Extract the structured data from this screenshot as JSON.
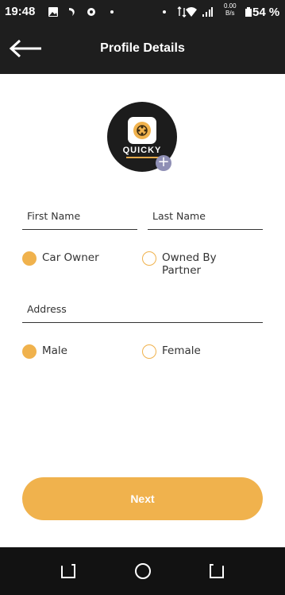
{
  "status_bar": {
    "time": "19:48",
    "net_speed_value": "0.00",
    "net_speed_unit": "B/s",
    "battery": "54 %",
    "icons": [
      "gallery-icon",
      "app-icon",
      "settings-icon",
      "dot-icon",
      "dot-icon",
      "data-arrows-icon",
      "wifi-icon",
      "signal-icon",
      "battery-icon"
    ]
  },
  "app_bar": {
    "title": "Profile Details",
    "back_icon": "back-arrow-icon"
  },
  "logo": {
    "text": "QUICKY",
    "add_icon": "plus-icon"
  },
  "form": {
    "first_name": {
      "label": "First Name",
      "value": ""
    },
    "last_name": {
      "label": "Last Name",
      "value": ""
    },
    "ownership": {
      "options": [
        "Car Owner",
        "Owned By Partner"
      ],
      "selected": "Car Owner"
    },
    "address": {
      "label": "Address",
      "value": ""
    },
    "gender": {
      "options": [
        "Male",
        "Female"
      ],
      "selected": "Male"
    }
  },
  "next_button": {
    "label": "Next"
  },
  "nav_bar": {
    "icons": [
      "recents-icon",
      "home-icon",
      "back-icon"
    ]
  },
  "colors": {
    "accent": "#f0b24d",
    "bar_background": "#1e1e1e",
    "text": "#333333"
  }
}
